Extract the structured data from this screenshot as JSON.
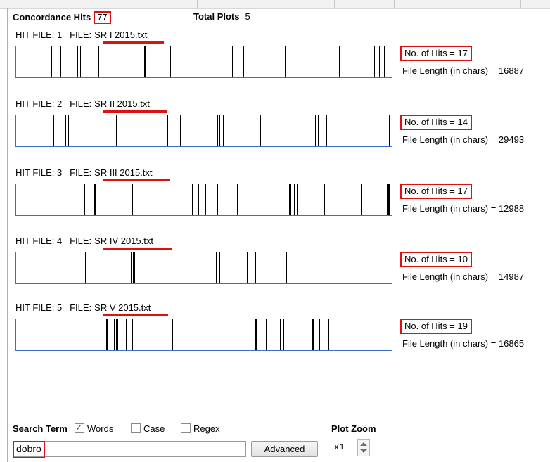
{
  "header": {
    "concordance_label": "Concordance Hits",
    "concordance_count": "77",
    "total_plots_label": "Total Plots",
    "total_plots_value": "5"
  },
  "plots": [
    {
      "hit_file_label": "HIT FILE: 1",
      "file_prefix": "FILE:",
      "file_name": "SR I 2015.txt",
      "hits_text": "No. of Hits = 17",
      "length_text": "File Length (in chars) = 16887",
      "hit_positions": [
        0.093,
        0.117,
        0.162,
        0.171,
        0.18,
        0.219,
        0.34,
        0.358,
        0.41,
        0.575,
        0.604,
        0.716,
        0.86,
        0.888,
        0.953,
        0.967,
        0.98
      ]
    },
    {
      "hit_file_label": "HIT FILE: 2",
      "file_prefix": "FILE:",
      "file_name": "SR II 2015.txt",
      "hits_text": "No. of Hits = 14",
      "length_text": "File Length (in chars) = 29493",
      "hit_positions": [
        0.099,
        0.13,
        0.139,
        0.266,
        0.402,
        0.436,
        0.534,
        0.542,
        0.551,
        0.65,
        0.795,
        0.804,
        0.826,
        0.993
      ]
    },
    {
      "hit_file_label": "HIT FILE: 3",
      "file_prefix": "FILE:",
      "file_name": "SR III 2015.txt",
      "hits_text": "No. of Hits = 17",
      "length_text": "File Length (in chars) = 12988",
      "hit_positions": [
        0.181,
        0.207,
        0.309,
        0.468,
        0.485,
        0.504,
        0.534,
        0.588,
        0.698,
        0.726,
        0.73,
        0.739,
        0.748,
        0.82,
        0.918,
        0.986,
        0.991
      ]
    },
    {
      "hit_file_label": "HIT FILE: 4",
      "file_prefix": "FILE:",
      "file_name": "SR IV 2015.txt",
      "hits_text": "No. of Hits = 10",
      "length_text": "File Length (in chars) = 14987",
      "hit_positions": [
        0.184,
        0.305,
        0.31,
        0.315,
        0.489,
        0.532,
        0.539,
        0.615,
        0.637,
        0.719
      ]
    },
    {
      "hit_file_label": "HIT FILE: 5",
      "file_prefix": "FILE:",
      "file_name": "SR V 2015.txt",
      "hits_text": "No. of Hits = 19",
      "length_text": "File Length (in chars) = 16865",
      "hit_positions": [
        0.23,
        0.24,
        0.26,
        0.266,
        0.27,
        0.293,
        0.308,
        0.312,
        0.319,
        0.376,
        0.416,
        0.636,
        0.665,
        0.703,
        0.712,
        0.779,
        0.789,
        0.808,
        0.831
      ]
    }
  ],
  "footer": {
    "search_term_label": "Search Term",
    "words_label": "Words",
    "words_checked": true,
    "case_label": "Case",
    "case_checked": false,
    "regex_label": "Regex",
    "regex_checked": false,
    "plot_zoom_label": "Plot Zoom",
    "search_value": "dobro",
    "advanced_label": "Advanced",
    "zoom_value": "x1"
  },
  "colors": {
    "highlight": "#e01010",
    "plot_border": "#3a6fd0",
    "hit_line": "#000000"
  }
}
